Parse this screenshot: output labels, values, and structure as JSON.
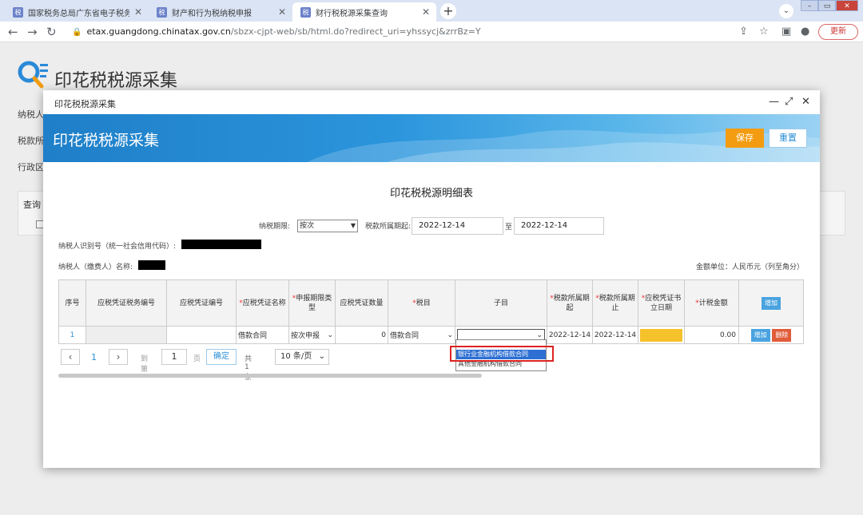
{
  "browser": {
    "tabs": [
      {
        "title": "国家税务总局广东省电子税务局",
        "active": false
      },
      {
        "title": "财产和行为税纳税申报",
        "active": false
      },
      {
        "title": "财行税税源采集查询",
        "active": true
      }
    ],
    "url_host": "etax.guangdong.chinatax.gov.cn",
    "url_path": "/sbzx-cjpt-web/sb/html.do?redirect_uri=yhssycj&zrrBz=Y",
    "update_label": "更新"
  },
  "page": {
    "title": "印花税税源采集",
    "labels": [
      "纳税人",
      "税款所",
      "行政区"
    ],
    "query_label": "查询"
  },
  "modal": {
    "title": "印花税税源采集",
    "banner_title": "印花税税源采集",
    "save_label": "保存",
    "reset_label": "重置",
    "form_title": "印花税税源明细表",
    "period_type_label": "纳税期限:",
    "period_type_value": "按次",
    "period_label": "税款所属期起:",
    "period_start": "2022-12-14",
    "to_label": "至",
    "period_end": "2022-12-14",
    "taxpayer_id_label": "纳税人识别号（统一社会信用代码）:",
    "taxpayer_name_label": "纳税人（缴费人）名称:",
    "unit_label": "金额单位：人民币元（列至角分）"
  },
  "table": {
    "headers": [
      "序号",
      "应税凭证税务编号",
      "应税凭证编号",
      "应税凭证名称",
      "申报期限类型",
      "应税凭证数量",
      "税目",
      "子目",
      "税款所属期起",
      "税款所属期止",
      "应税凭证书立日期",
      "计税金额"
    ],
    "add_label": "增加",
    "row": {
      "index": "1",
      "voucher_name": "借款合同",
      "period_type": "按次申报",
      "quantity": "0",
      "tax_item": "借款合同",
      "sub_item": "",
      "start": "2022-12-14",
      "end": "2022-12-14",
      "amount": "0.00",
      "add_label": "增加",
      "delete_label": "删除"
    }
  },
  "dropdown": {
    "options": [
      "",
      "银行业金融机构借款合同",
      "其他金融机构借款合同"
    ],
    "selected_index": 1
  },
  "pager": {
    "page": "1",
    "goto_label": "到第",
    "goto_value": "1",
    "page_unit": "页",
    "confirm_label": "确定",
    "total_label": "共 1 条",
    "size_label": "10 条/页"
  },
  "colors": {
    "banner": "#2b95dc",
    "save": "#f39c12",
    "delete": "#e05c3a",
    "highlight": "#d22222"
  }
}
